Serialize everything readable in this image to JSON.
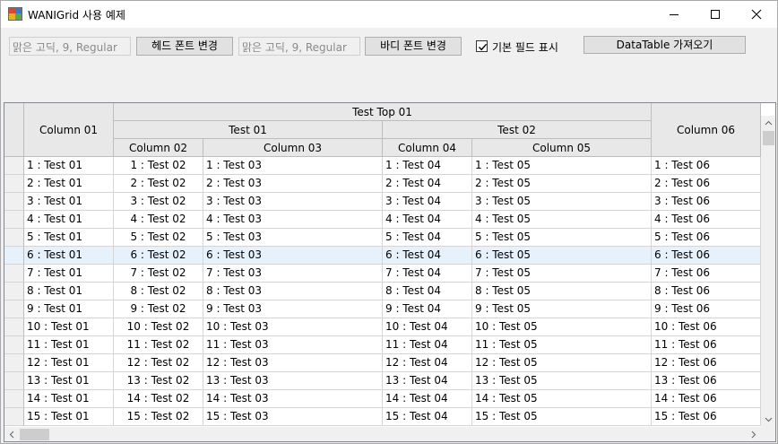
{
  "window": {
    "title": "WANIGrid 사용 예제"
  },
  "toolbar": {
    "head_font_value": "맑은 고딕, 9, Regular",
    "head_font_button": "헤드 폰트 변경",
    "body_font_value": "맑은 고딕, 9, Regular",
    "body_font_button": "바디 폰트 변경",
    "show_default_fields_label": "기본 필드 표시",
    "show_default_fields_checked": true,
    "get_datatable_button": "DataTable 가져오기"
  },
  "grid": {
    "header": {
      "top_group": "Test Top 01",
      "group_1": "Test 01",
      "group_2": "Test 02",
      "columns": [
        "Column 01",
        "Column 02",
        "Column 03",
        "Column 04",
        "Column 05",
        "Column 06"
      ]
    },
    "selected_row_index": 5,
    "rows": [
      [
        "1 : Test 01",
        "1 : Test 02",
        "1 : Test 03",
        "1 : Test 04",
        "1 : Test 05",
        "1 : Test 06"
      ],
      [
        "2 : Test 01",
        "2 : Test 02",
        "2 : Test 03",
        "2 : Test 04",
        "2 : Test 05",
        "2 : Test 06"
      ],
      [
        "3 : Test 01",
        "3 : Test 02",
        "3 : Test 03",
        "3 : Test 04",
        "3 : Test 05",
        "3 : Test 06"
      ],
      [
        "4 : Test 01",
        "4 : Test 02",
        "4 : Test 03",
        "4 : Test 04",
        "4 : Test 05",
        "4 : Test 06"
      ],
      [
        "5 : Test 01",
        "5 : Test 02",
        "5 : Test 03",
        "5 : Test 04",
        "5 : Test 05",
        "5 : Test 06"
      ],
      [
        "6 : Test 01",
        "6 : Test 02",
        "6 : Test 03",
        "6 : Test 04",
        "6 : Test 05",
        "6 : Test 06"
      ],
      [
        "7 : Test 01",
        "7 : Test 02",
        "7 : Test 03",
        "7 : Test 04",
        "7 : Test 05",
        "7 : Test 06"
      ],
      [
        "8 : Test 01",
        "8 : Test 02",
        "8 : Test 03",
        "8 : Test 04",
        "8 : Test 05",
        "8 : Test 06"
      ],
      [
        "9 : Test 01",
        "9 : Test 02",
        "9 : Test 03",
        "9 : Test 04",
        "9 : Test 05",
        "9 : Test 06"
      ],
      [
        "10 : Test 01",
        "10 : Test 02",
        "10 : Test 03",
        "10 : Test 04",
        "10 : Test 05",
        "10 : Test 06"
      ],
      [
        "11 : Test 01",
        "11 : Test 02",
        "11 : Test 03",
        "11 : Test 04",
        "11 : Test 05",
        "11 : Test 06"
      ],
      [
        "12 : Test 01",
        "12 : Test 02",
        "12 : Test 03",
        "12 : Test 04",
        "12 : Test 05",
        "12 : Test 06"
      ],
      [
        "13 : Test 01",
        "13 : Test 02",
        "13 : Test 03",
        "13 : Test 04",
        "13 : Test 05",
        "13 : Test 06"
      ],
      [
        "14 : Test 01",
        "14 : Test 02",
        "14 : Test 03",
        "14 : Test 04",
        "14 : Test 05",
        "14 : Test 06"
      ],
      [
        "15 : Test 01",
        "15 : Test 02",
        "15 : Test 03",
        "15 : Test 04",
        "15 : Test 05",
        "15 : Test 06"
      ]
    ]
  }
}
